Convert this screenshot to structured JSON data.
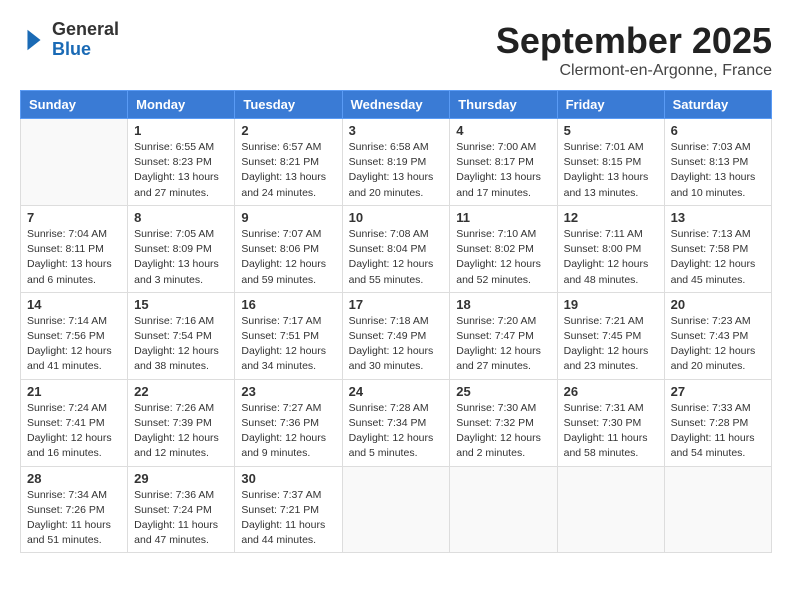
{
  "header": {
    "logo": {
      "line1": "General",
      "line2": "Blue"
    },
    "title": "September 2025",
    "location": "Clermont-en-Argonne, France"
  },
  "weekdays": [
    "Sunday",
    "Monday",
    "Tuesday",
    "Wednesday",
    "Thursday",
    "Friday",
    "Saturday"
  ],
  "weeks": [
    [
      {
        "day": "",
        "info": ""
      },
      {
        "day": "1",
        "info": "Sunrise: 6:55 AM\nSunset: 8:23 PM\nDaylight: 13 hours\nand 27 minutes."
      },
      {
        "day": "2",
        "info": "Sunrise: 6:57 AM\nSunset: 8:21 PM\nDaylight: 13 hours\nand 24 minutes."
      },
      {
        "day": "3",
        "info": "Sunrise: 6:58 AM\nSunset: 8:19 PM\nDaylight: 13 hours\nand 20 minutes."
      },
      {
        "day": "4",
        "info": "Sunrise: 7:00 AM\nSunset: 8:17 PM\nDaylight: 13 hours\nand 17 minutes."
      },
      {
        "day": "5",
        "info": "Sunrise: 7:01 AM\nSunset: 8:15 PM\nDaylight: 13 hours\nand 13 minutes."
      },
      {
        "day": "6",
        "info": "Sunrise: 7:03 AM\nSunset: 8:13 PM\nDaylight: 13 hours\nand 10 minutes."
      }
    ],
    [
      {
        "day": "7",
        "info": "Sunrise: 7:04 AM\nSunset: 8:11 PM\nDaylight: 13 hours\nand 6 minutes."
      },
      {
        "day": "8",
        "info": "Sunrise: 7:05 AM\nSunset: 8:09 PM\nDaylight: 13 hours\nand 3 minutes."
      },
      {
        "day": "9",
        "info": "Sunrise: 7:07 AM\nSunset: 8:06 PM\nDaylight: 12 hours\nand 59 minutes."
      },
      {
        "day": "10",
        "info": "Sunrise: 7:08 AM\nSunset: 8:04 PM\nDaylight: 12 hours\nand 55 minutes."
      },
      {
        "day": "11",
        "info": "Sunrise: 7:10 AM\nSunset: 8:02 PM\nDaylight: 12 hours\nand 52 minutes."
      },
      {
        "day": "12",
        "info": "Sunrise: 7:11 AM\nSunset: 8:00 PM\nDaylight: 12 hours\nand 48 minutes."
      },
      {
        "day": "13",
        "info": "Sunrise: 7:13 AM\nSunset: 7:58 PM\nDaylight: 12 hours\nand 45 minutes."
      }
    ],
    [
      {
        "day": "14",
        "info": "Sunrise: 7:14 AM\nSunset: 7:56 PM\nDaylight: 12 hours\nand 41 minutes."
      },
      {
        "day": "15",
        "info": "Sunrise: 7:16 AM\nSunset: 7:54 PM\nDaylight: 12 hours\nand 38 minutes."
      },
      {
        "day": "16",
        "info": "Sunrise: 7:17 AM\nSunset: 7:51 PM\nDaylight: 12 hours\nand 34 minutes."
      },
      {
        "day": "17",
        "info": "Sunrise: 7:18 AM\nSunset: 7:49 PM\nDaylight: 12 hours\nand 30 minutes."
      },
      {
        "day": "18",
        "info": "Sunrise: 7:20 AM\nSunset: 7:47 PM\nDaylight: 12 hours\nand 27 minutes."
      },
      {
        "day": "19",
        "info": "Sunrise: 7:21 AM\nSunset: 7:45 PM\nDaylight: 12 hours\nand 23 minutes."
      },
      {
        "day": "20",
        "info": "Sunrise: 7:23 AM\nSunset: 7:43 PM\nDaylight: 12 hours\nand 20 minutes."
      }
    ],
    [
      {
        "day": "21",
        "info": "Sunrise: 7:24 AM\nSunset: 7:41 PM\nDaylight: 12 hours\nand 16 minutes."
      },
      {
        "day": "22",
        "info": "Sunrise: 7:26 AM\nSunset: 7:39 PM\nDaylight: 12 hours\nand 12 minutes."
      },
      {
        "day": "23",
        "info": "Sunrise: 7:27 AM\nSunset: 7:36 PM\nDaylight: 12 hours\nand 9 minutes."
      },
      {
        "day": "24",
        "info": "Sunrise: 7:28 AM\nSunset: 7:34 PM\nDaylight: 12 hours\nand 5 minutes."
      },
      {
        "day": "25",
        "info": "Sunrise: 7:30 AM\nSunset: 7:32 PM\nDaylight: 12 hours\nand 2 minutes."
      },
      {
        "day": "26",
        "info": "Sunrise: 7:31 AM\nSunset: 7:30 PM\nDaylight: 11 hours\nand 58 minutes."
      },
      {
        "day": "27",
        "info": "Sunrise: 7:33 AM\nSunset: 7:28 PM\nDaylight: 11 hours\nand 54 minutes."
      }
    ],
    [
      {
        "day": "28",
        "info": "Sunrise: 7:34 AM\nSunset: 7:26 PM\nDaylight: 11 hours\nand 51 minutes."
      },
      {
        "day": "29",
        "info": "Sunrise: 7:36 AM\nSunset: 7:24 PM\nDaylight: 11 hours\nand 47 minutes."
      },
      {
        "day": "30",
        "info": "Sunrise: 7:37 AM\nSunset: 7:21 PM\nDaylight: 11 hours\nand 44 minutes."
      },
      {
        "day": "",
        "info": ""
      },
      {
        "day": "",
        "info": ""
      },
      {
        "day": "",
        "info": ""
      },
      {
        "day": "",
        "info": ""
      }
    ]
  ]
}
